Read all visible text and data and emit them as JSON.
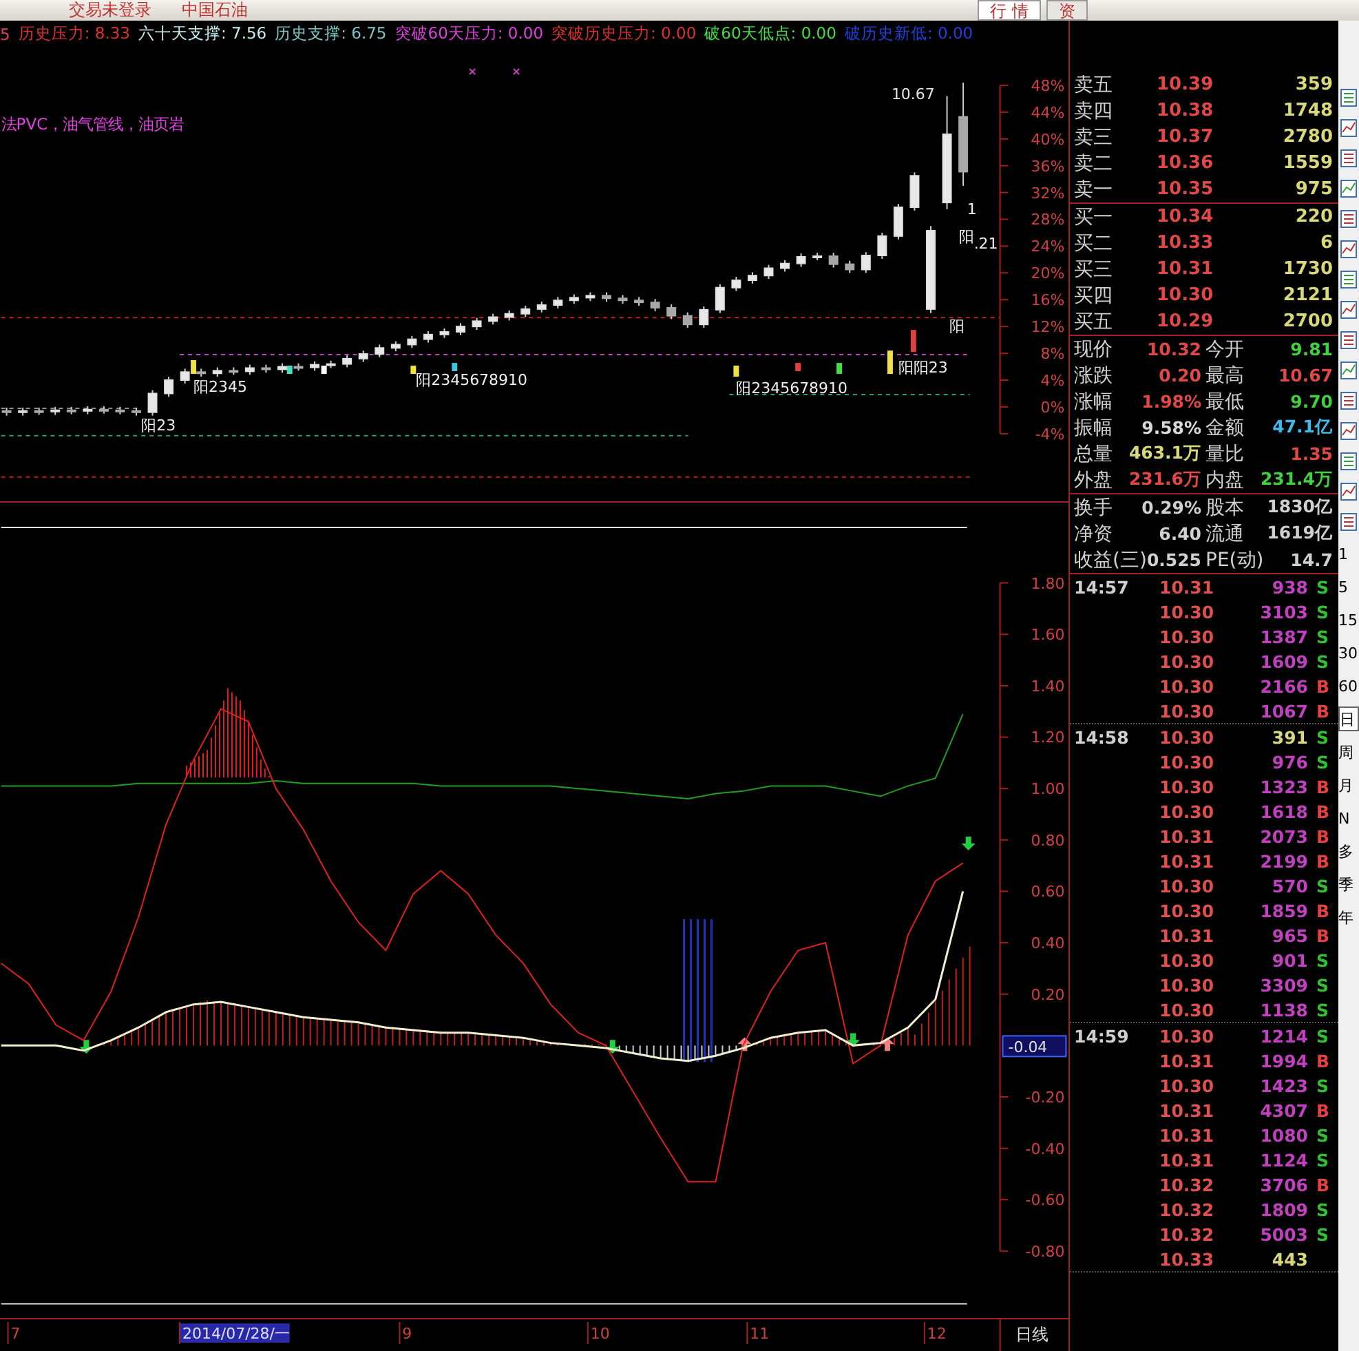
{
  "menu_bar": {
    "items": [
      "交易未登录",
      "中国石油"
    ],
    "tabs": [
      {
        "label": "行 情",
        "selected": true
      },
      {
        "label": "资",
        "selected": false
      }
    ]
  },
  "indicator_line": [
    {
      "text": "5",
      "color": "#e0406a"
    },
    {
      "text": "历史压力: 8.33",
      "color": "#e03030"
    },
    {
      "text": "六十天支撑: 7.56",
      "color": "#c8f0f0"
    },
    {
      "text": "历史支撑: 6.75",
      "color": "#80c8c8"
    },
    {
      "text": "突破60天压力: 0.00",
      "color": "#e040e0"
    },
    {
      "text": "突破历史压力: 0.00",
      "color": "#e03030"
    },
    {
      "text": "破60天低点: 0.00",
      "color": "#40e040"
    },
    {
      "text": "破历史新低: 0.00",
      "color": "#2040e0"
    }
  ],
  "concept_text": "法PVC，油气管线，油页岩",
  "price_chart": {
    "high_label": "10.67",
    "signal_labels": [
      "1",
      "阳",
      ".21",
      "阳",
      "阳阳23",
      "阳2345678910",
      "阳2345",
      "阳2345678910",
      "阳23"
    ],
    "chart_data": {
      "type": "candlestick",
      "ylim": [
        -4,
        48
      ],
      "categories": [
        null,
        null,
        null,
        null,
        null,
        null,
        null,
        null,
        null,
        null,
        null,
        null,
        null,
        null,
        null,
        null,
        null,
        null,
        null,
        null,
        null,
        null,
        null,
        null,
        null,
        null,
        null,
        null,
        null,
        null,
        null,
        null,
        null,
        null,
        null,
        null,
        null,
        null,
        null,
        null,
        null,
        null,
        null,
        null,
        null,
        null,
        null,
        null,
        null,
        null,
        null,
        null,
        null,
        null,
        null,
        null,
        null,
        null,
        null,
        null
      ],
      "yticks": [
        {
          "value": 48,
          "label": "48%"
        },
        {
          "value": 44,
          "label": "44%"
        },
        {
          "value": 40,
          "label": "40%"
        },
        {
          "value": 36,
          "label": "36%"
        },
        {
          "value": 32,
          "label": "32%"
        },
        {
          "value": 28,
          "label": "28%"
        },
        {
          "value": 24,
          "label": "24%"
        },
        {
          "value": 20,
          "label": "20%"
        },
        {
          "value": 16,
          "label": "16%"
        },
        {
          "value": 12,
          "label": "12%"
        },
        {
          "value": 8,
          "label": "8%"
        },
        {
          "value": 4,
          "label": "4%"
        },
        {
          "value": 0,
          "label": "0%"
        },
        {
          "value": -4,
          "label": "-4%"
        }
      ],
      "ohlc": [
        [
          -0.6,
          -0.1,
          -1.3,
          -0.8
        ],
        [
          -0.8,
          -0.1,
          -1.3,
          -0.6
        ],
        [
          -0.6,
          -0.1,
          -1.2,
          -0.7
        ],
        [
          -0.7,
          0.0,
          -1.2,
          -0.5
        ],
        [
          -0.5,
          0.0,
          -1.1,
          -0.6
        ],
        [
          -0.6,
          0.1,
          -1.1,
          -0.4
        ],
        [
          -0.4,
          0.1,
          -1.0,
          -0.5
        ],
        [
          -0.5,
          0.0,
          -1.1,
          -0.6
        ],
        [
          -0.6,
          -0.1,
          -1.3,
          -0.8
        ],
        [
          -0.8,
          2.5,
          -1.3,
          2.0
        ],
        [
          2.0,
          4.5,
          1.5,
          4.0
        ],
        [
          4.0,
          5.7,
          3.5,
          5.2
        ],
        [
          5.2,
          5.7,
          4.5,
          5.0
        ],
        [
          5.0,
          5.9,
          4.5,
          5.4
        ],
        [
          5.4,
          5.9,
          4.8,
          5.3
        ],
        [
          5.3,
          6.3,
          4.8,
          5.8
        ],
        [
          5.8,
          6.3,
          5.1,
          5.6
        ],
        [
          5.6,
          6.5,
          5.1,
          6.0
        ],
        [
          6.0,
          6.5,
          5.4,
          5.9
        ],
        [
          5.9,
          6.8,
          5.4,
          6.3
        ],
        [
          6.3,
          6.9,
          5.8,
          6.4
        ],
        [
          6.4,
          7.7,
          5.9,
          7.2
        ],
        [
          7.2,
          8.4,
          6.7,
          7.9
        ],
        [
          7.9,
          9.3,
          7.4,
          8.8
        ],
        [
          8.8,
          9.8,
          8.3,
          9.3
        ],
        [
          9.3,
          10.6,
          8.8,
          10.1
        ],
        [
          10.1,
          11.3,
          9.6,
          10.8
        ],
        [
          10.8,
          11.7,
          10.3,
          11.2
        ],
        [
          11.2,
          12.5,
          10.7,
          12.0
        ],
        [
          12.0,
          13.3,
          11.5,
          12.8
        ],
        [
          12.8,
          13.9,
          12.3,
          13.4
        ],
        [
          13.4,
          14.4,
          12.9,
          13.9
        ],
        [
          13.9,
          15.1,
          13.4,
          14.6
        ],
        [
          14.6,
          15.7,
          14.1,
          15.2
        ],
        [
          15.2,
          16.4,
          14.7,
          15.9
        ],
        [
          15.9,
          16.8,
          15.4,
          16.3
        ],
        [
          16.3,
          17.1,
          15.8,
          16.6
        ],
        [
          16.6,
          17.1,
          15.7,
          16.2
        ],
        [
          16.2,
          16.7,
          15.4,
          15.9
        ],
        [
          15.9,
          16.4,
          15.1,
          15.6
        ],
        [
          15.6,
          16.1,
          14.3,
          14.8
        ],
        [
          14.8,
          15.3,
          13.1,
          13.6
        ],
        [
          13.6,
          14.1,
          11.8,
          12.3
        ],
        [
          12.3,
          15.0,
          11.8,
          14.5
        ],
        [
          14.5,
          18.3,
          14.0,
          17.8
        ],
        [
          17.8,
          19.4,
          17.3,
          18.9
        ],
        [
          18.9,
          20.1,
          18.4,
          19.6
        ],
        [
          19.6,
          21.2,
          19.1,
          20.7
        ],
        [
          20.7,
          21.9,
          20.2,
          21.4
        ],
        [
          21.4,
          22.9,
          20.9,
          22.4
        ],
        [
          22.4,
          23.0,
          21.9,
          22.5
        ],
        [
          22.5,
          23.0,
          20.8,
          21.3
        ],
        [
          21.3,
          21.8,
          20.0,
          20.5
        ],
        [
          20.5,
          23.1,
          20.0,
          22.6
        ],
        [
          22.6,
          26.0,
          22.1,
          25.5
        ],
        [
          25.5,
          30.3,
          25.0,
          29.8
        ],
        [
          29.8,
          35.0,
          29.3,
          34.5
        ],
        [
          14.6,
          27.0,
          14.0,
          26.3
        ],
        [
          30.5,
          46.4,
          29.5,
          40.7
        ],
        [
          43.3,
          48.4,
          33.0,
          35.1
        ]
      ]
    }
  },
  "indicator_chart": {
    "reading": "-0.04",
    "chart_data": {
      "type": "line",
      "ylim": [
        -0.8,
        1.8
      ],
      "yticks": [
        {
          "value": 1.8,
          "label": "1.80"
        },
        {
          "value": 1.6,
          "label": "1.60"
        },
        {
          "value": 1.4,
          "label": "1.40"
        },
        {
          "value": 1.2,
          "label": "1.20"
        },
        {
          "value": 1.0,
          "label": "1.00"
        },
        {
          "value": 0.8,
          "label": "0.80"
        },
        {
          "value": 0.6,
          "label": "0.60"
        },
        {
          "value": 0.4,
          "label": "0.40"
        },
        {
          "value": 0.2,
          "label": "0.20"
        },
        {
          "value": -0.2,
          "label": "-0.20"
        },
        {
          "value": -0.4,
          "label": "-0.40"
        },
        {
          "value": -0.6,
          "label": "-0.60"
        },
        {
          "value": -0.8,
          "label": "-0.80"
        }
      ],
      "series": [
        {
          "color": "#20a020",
          "values": [
            1.01,
            1.01,
            1.01,
            1.01,
            1.01,
            1.02,
            1.02,
            1.02,
            1.02,
            1.02,
            1.03,
            1.02,
            1.02,
            1.02,
            1.02,
            1.02,
            1.01,
            1.01,
            1.01,
            1.01,
            1.01,
            1.0,
            0.99,
            0.98,
            0.97,
            0.96,
            0.98,
            0.99,
            1.01,
            1.01,
            1.01,
            0.99,
            0.97,
            1.01,
            1.04,
            1.29
          ]
        },
        {
          "color": "#e02020",
          "values": [
            0.32,
            0.24,
            0.08,
            0.02,
            0.21,
            0.5,
            0.86,
            1.11,
            1.31,
            1.26,
            1.0,
            0.84,
            0.64,
            0.48,
            0.37,
            0.59,
            0.68,
            0.59,
            0.43,
            0.32,
            0.16,
            0.05,
            0.0,
            -0.18,
            -0.36,
            -0.53,
            -0.53,
            0.0,
            0.21,
            0.37,
            0.4,
            -0.07,
            0.0,
            0.43,
            0.64,
            0.71
          ]
        },
        {
          "color": "#f0f0d0",
          "values": [
            0,
            0,
            0,
            -0.02,
            0.02,
            0.07,
            0.13,
            0.16,
            0.17,
            0.15,
            0.13,
            0.11,
            0.1,
            0.09,
            0.07,
            0.06,
            0.05,
            0.05,
            0.04,
            0.03,
            0.01,
            0.0,
            -0.01,
            -0.03,
            -0.05,
            -0.06,
            -0.04,
            -0.01,
            0.03,
            0.05,
            0.06,
            0.0,
            0.01,
            0.07,
            0.18,
            0.6
          ]
        }
      ]
    }
  },
  "time_axis": {
    "ticks": [
      {
        "label": "7",
        "selected": false
      },
      {
        "label": "2014/07/28/一",
        "selected": true
      },
      {
        "label": "9",
        "selected": false
      },
      {
        "label": "10",
        "selected": false
      },
      {
        "label": "11",
        "selected": false
      },
      {
        "label": "12",
        "selected": false
      }
    ],
    "period": "日线"
  },
  "order_book": {
    "asks": [
      {
        "label": "卖五",
        "price": "10.39",
        "volume": "359"
      },
      {
        "label": "卖四",
        "price": "10.38",
        "volume": "1748"
      },
      {
        "label": "卖三",
        "price": "10.37",
        "volume": "2780"
      },
      {
        "label": "卖二",
        "price": "10.36",
        "volume": "1559"
      },
      {
        "label": "卖一",
        "price": "10.35",
        "volume": "975"
      }
    ],
    "bids": [
      {
        "label": "买一",
        "price": "10.34",
        "volume": "220"
      },
      {
        "label": "买二",
        "price": "10.33",
        "volume": "6"
      },
      {
        "label": "买三",
        "price": "10.31",
        "volume": "1730"
      },
      {
        "label": "买四",
        "price": "10.30",
        "volume": "2121"
      },
      {
        "label": "买五",
        "price": "10.29",
        "volume": "2700"
      }
    ]
  },
  "stats": [
    [
      {
        "label": "现价",
        "value": "10.32",
        "color": "#e04848"
      },
      {
        "label": "今开",
        "value": "9.81",
        "color": "#40d040"
      }
    ],
    [
      {
        "label": "涨跌",
        "value": "0.20",
        "color": "#e04848"
      },
      {
        "label": "最高",
        "value": "10.67",
        "color": "#e04848"
      }
    ],
    [
      {
        "label": "涨幅",
        "value": "1.98%",
        "color": "#e04848"
      },
      {
        "label": "最低",
        "value": "9.70",
        "color": "#40d040"
      }
    ],
    [
      {
        "label": "振幅",
        "value": "9.58%",
        "color": "#d8d8d8"
      },
      {
        "label": "金额",
        "value": "47.1亿",
        "color": "#40b8e8"
      }
    ],
    [
      {
        "label": "总量",
        "value": "463.1万",
        "color": "#d8d878"
      },
      {
        "label": "量比",
        "value": "1.35",
        "color": "#e04848"
      }
    ],
    [
      {
        "label": "外盘",
        "value": "231.6万",
        "color": "#e04848"
      },
      {
        "label": "内盘",
        "value": "231.4万",
        "color": "#40d040"
      }
    ]
  ],
  "company": [
    [
      {
        "label": "换手",
        "value": "0.29%"
      },
      {
        "label": "股本",
        "value": "1830亿"
      }
    ],
    [
      {
        "label": "净资",
        "value": "6.40"
      },
      {
        "label": "流通",
        "value": "1619亿"
      }
    ],
    [
      {
        "label": "收益(三)",
        "value": "0.525"
      },
      {
        "label": "PE(动)",
        "value": "14.7"
      }
    ]
  ],
  "trades": [
    {
      "time": "14:57",
      "rows": [
        {
          "price": "10.31",
          "volume": "938",
          "side": "S",
          "kind": "sell",
          "color": "#c040c0"
        },
        {
          "price": "10.30",
          "volume": "3103",
          "side": "S",
          "kind": "sell",
          "color": "#c040c0"
        },
        {
          "price": "10.30",
          "volume": "1387",
          "side": "S",
          "kind": "sell",
          "color": "#c040c0"
        },
        {
          "price": "10.30",
          "volume": "1609",
          "side": "S",
          "kind": "sell",
          "color": "#c040c0"
        },
        {
          "price": "10.30",
          "volume": "2166",
          "side": "B",
          "kind": "buy",
          "color": "#c040c0"
        },
        {
          "price": "10.30",
          "volume": "1067",
          "side": "B",
          "kind": "buy",
          "color": "#c040c0"
        }
      ]
    },
    {
      "time": "14:58",
      "rows": [
        {
          "price": "10.30",
          "volume": "391",
          "side": "S",
          "kind": "sell",
          "color": "#d8d878"
        },
        {
          "price": "10.30",
          "volume": "976",
          "side": "S",
          "kind": "sell",
          "color": "#c040c0"
        },
        {
          "price": "10.30",
          "volume": "1323",
          "side": "B",
          "kind": "buy",
          "color": "#c040c0"
        },
        {
          "price": "10.30",
          "volume": "1618",
          "side": "B",
          "kind": "buy",
          "color": "#c040c0"
        },
        {
          "price": "10.31",
          "volume": "2073",
          "side": "B",
          "kind": "buy",
          "color": "#c040c0"
        },
        {
          "price": "10.31",
          "volume": "2199",
          "side": "B",
          "kind": "buy",
          "color": "#c040c0"
        },
        {
          "price": "10.30",
          "volume": "570",
          "side": "S",
          "kind": "sell",
          "color": "#c040c0"
        },
        {
          "price": "10.30",
          "volume": "1859",
          "side": "B",
          "kind": "buy",
          "color": "#c040c0"
        },
        {
          "price": "10.31",
          "volume": "965",
          "side": "B",
          "kind": "buy",
          "color": "#c040c0"
        },
        {
          "price": "10.30",
          "volume": "901",
          "side": "S",
          "kind": "sell",
          "color": "#c040c0"
        },
        {
          "price": "10.30",
          "volume": "3309",
          "side": "S",
          "kind": "sell",
          "color": "#c040c0"
        },
        {
          "price": "10.30",
          "volume": "1138",
          "side": "S",
          "kind": "sell",
          "color": "#c040c0"
        }
      ]
    },
    {
      "time": "14:59",
      "rows": [
        {
          "price": "10.30",
          "volume": "1214",
          "side": "S",
          "kind": "sell",
          "color": "#c040c0"
        },
        {
          "price": "10.31",
          "volume": "1994",
          "side": "B",
          "kind": "buy",
          "color": "#c040c0"
        },
        {
          "price": "10.30",
          "volume": "1423",
          "side": "S",
          "kind": "sell",
          "color": "#c040c0"
        },
        {
          "price": "10.31",
          "volume": "4307",
          "side": "B",
          "kind": "buy",
          "color": "#c040c0"
        },
        {
          "price": "10.31",
          "volume": "1080",
          "side": "S",
          "kind": "sell",
          "color": "#c040c0"
        },
        {
          "price": "10.31",
          "volume": "1124",
          "side": "S",
          "kind": "sell",
          "color": "#c040c0"
        },
        {
          "price": "10.32",
          "volume": "3706",
          "side": "B",
          "kind": "buy",
          "color": "#c040c0"
        },
        {
          "price": "10.32",
          "volume": "1809",
          "side": "S",
          "kind": "sell",
          "color": "#c040c0"
        },
        {
          "price": "10.32",
          "volume": "5003",
          "side": "S",
          "kind": "sell",
          "color": "#c040c0"
        },
        {
          "price": "10.33",
          "volume": "443",
          "kind": "neutral",
          "color": "#d8d878"
        }
      ]
    }
  ],
  "toolbar": {
    "periods": [
      {
        "label": "1",
        "selected": false
      },
      {
        "label": "5",
        "selected": false
      },
      {
        "label": "15",
        "selected": false
      },
      {
        "label": "30",
        "selected": false
      },
      {
        "label": "60",
        "selected": false
      },
      {
        "label": "日",
        "selected": true
      },
      {
        "label": "周",
        "selected": false
      },
      {
        "label": "月",
        "selected": false
      },
      {
        "label": "N",
        "selected": false
      },
      {
        "label": "多",
        "selected": false
      },
      {
        "label": "季",
        "selected": false
      },
      {
        "label": "年",
        "selected": false
      }
    ]
  }
}
